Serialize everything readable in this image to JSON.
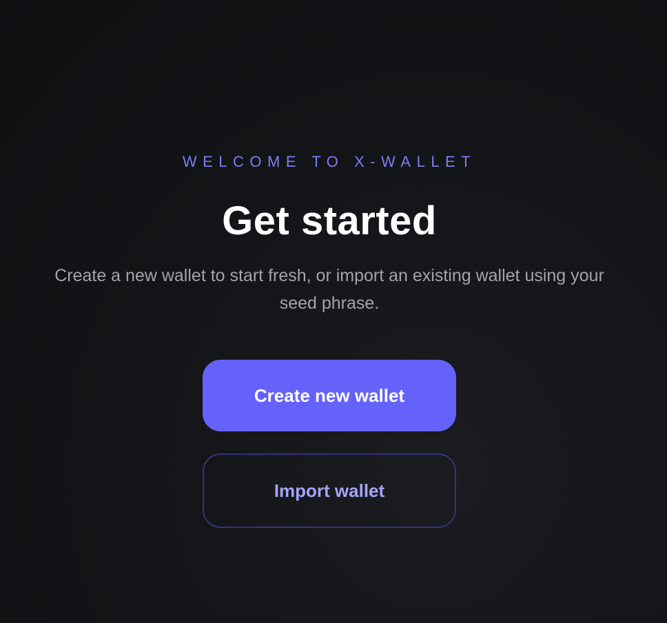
{
  "onboarding": {
    "eyebrow": "WELCOME TO X-WALLET",
    "title": "Get started",
    "subtitle": "Create a new wallet to start fresh, or import an existing wallet using your seed phrase.",
    "create_button_label": "Create new wallet",
    "import_button_label": "Import wallet"
  },
  "colors": {
    "accent": "#6462fa",
    "eyebrow": "#7e7cf5",
    "secondary_text": "#a4a3fa",
    "background": "#141518"
  }
}
